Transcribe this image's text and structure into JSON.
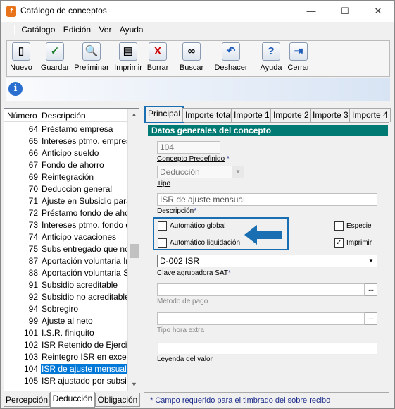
{
  "window": {
    "title": "Catálogo de conceptos",
    "app_icon": "f"
  },
  "menu": [
    "Catálogo",
    "Edición",
    "Ver",
    "Ayuda"
  ],
  "toolbar": [
    {
      "label": "Nuevo",
      "icon": "new-document-icon",
      "glyph": "▯"
    },
    {
      "label": "Guardar",
      "icon": "save-check-icon",
      "glyph": "✓"
    },
    {
      "label": "Preliminar",
      "icon": "preview-icon",
      "glyph": "🔍"
    },
    {
      "label": "Imprimir",
      "icon": "print-icon",
      "glyph": "▤"
    },
    {
      "label": "Borrar",
      "icon": "delete-icon",
      "glyph": "X"
    },
    {
      "label": "Buscar",
      "icon": "binoculars-icon",
      "glyph": "∞"
    },
    {
      "label": "Deshacer",
      "icon": "undo-icon",
      "glyph": "↶"
    },
    {
      "label": "Ayuda",
      "icon": "help-icon",
      "glyph": "?"
    },
    {
      "label": "Cerrar",
      "icon": "close-door-icon",
      "glyph": "⇥"
    }
  ],
  "list": {
    "headers": {
      "num": "Número",
      "desc": "Descripción"
    },
    "rows": [
      {
        "num": "64",
        "desc": "Préstamo empresa"
      },
      {
        "num": "65",
        "desc": "Intereses ptmo. empresa"
      },
      {
        "num": "66",
        "desc": "Anticipo sueldo"
      },
      {
        "num": "67",
        "desc": "Fondo de ahorro"
      },
      {
        "num": "69",
        "desc": "Reintegración"
      },
      {
        "num": "70",
        "desc": "Deduccion general"
      },
      {
        "num": "71",
        "desc": "Ajuste en Subsidio para el"
      },
      {
        "num": "72",
        "desc": "Préstamo fondo de ahorro"
      },
      {
        "num": "73",
        "desc": "Intereses ptmo. fondo de a"
      },
      {
        "num": "74",
        "desc": "Anticipo vacaciones"
      },
      {
        "num": "75",
        "desc": "Subs entregado que no co"
      },
      {
        "num": "87",
        "desc": "Aportación voluntaria Info"
      },
      {
        "num": "88",
        "desc": "Aportación voluntaria SAR"
      },
      {
        "num": "91",
        "desc": "Subsidio acreditable"
      },
      {
        "num": "92",
        "desc": "Subsidio no acreditable"
      },
      {
        "num": "94",
        "desc": "Sobregiro"
      },
      {
        "num": "99",
        "desc": "Ajuste al neto"
      },
      {
        "num": "101",
        "desc": "I.S.R. finiquito"
      },
      {
        "num": "102",
        "desc": "ISR Retenido de Ejercicio"
      },
      {
        "num": "103",
        "desc": "Reintegro ISR en exceso"
      },
      {
        "num": "104",
        "desc": "ISR de ajuste mensual"
      },
      {
        "num": "105",
        "desc": "ISR ajustado por subsidio"
      }
    ],
    "selected_index": 20
  },
  "bottom_tabs": [
    "Percepción",
    "Deducción",
    "Obligación"
  ],
  "bottom_tab_active": 1,
  "tabs": [
    "Principal",
    "Importe total",
    "Importe 1",
    "Importe 2",
    "Importe 3",
    "Importe 4"
  ],
  "tab_active": 0,
  "section_title": "Datos generales del concepto",
  "form": {
    "number_value": "104",
    "predef_label": "Concepto Predefinido",
    "required_star": "*",
    "predef_value": "Deducción",
    "tipo_label": "Tipo",
    "desc_value": "ISR de ajuste mensual",
    "desc_label": "Descripción",
    "auto_global": "Automático global",
    "auto_liq": "Automático liquidación",
    "especie": "Especie",
    "imprimir": "Imprimir",
    "imprimir_checked": "✓",
    "clave_value": "D-002  ISR",
    "clave_label": "Clave agrupadora SAT",
    "metodo_label": "Método de pago",
    "tipo_hora_label": "Tipo hora extra",
    "leyenda_label": "Leyenda del valor",
    "dots": "..."
  },
  "footer": "* Campo requerido para el timbrado del sobre recibo",
  "colors": {
    "section": "#007a73",
    "highlight": "#1a6fb3",
    "selection": "#0078d7"
  }
}
